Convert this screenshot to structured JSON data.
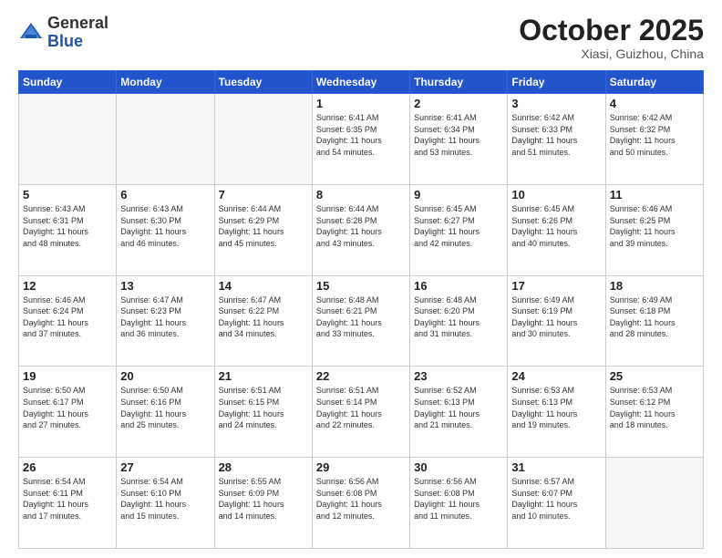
{
  "header": {
    "logo_general": "General",
    "logo_blue": "Blue",
    "month_title": "October 2025",
    "location": "Xiasi, Guizhou, China"
  },
  "days_of_week": [
    "Sunday",
    "Monday",
    "Tuesday",
    "Wednesday",
    "Thursday",
    "Friday",
    "Saturday"
  ],
  "weeks": [
    [
      {
        "day": "",
        "info": ""
      },
      {
        "day": "",
        "info": ""
      },
      {
        "day": "",
        "info": ""
      },
      {
        "day": "1",
        "info": "Sunrise: 6:41 AM\nSunset: 6:35 PM\nDaylight: 11 hours\nand 54 minutes."
      },
      {
        "day": "2",
        "info": "Sunrise: 6:41 AM\nSunset: 6:34 PM\nDaylight: 11 hours\nand 53 minutes."
      },
      {
        "day": "3",
        "info": "Sunrise: 6:42 AM\nSunset: 6:33 PM\nDaylight: 11 hours\nand 51 minutes."
      },
      {
        "day": "4",
        "info": "Sunrise: 6:42 AM\nSunset: 6:32 PM\nDaylight: 11 hours\nand 50 minutes."
      }
    ],
    [
      {
        "day": "5",
        "info": "Sunrise: 6:43 AM\nSunset: 6:31 PM\nDaylight: 11 hours\nand 48 minutes."
      },
      {
        "day": "6",
        "info": "Sunrise: 6:43 AM\nSunset: 6:30 PM\nDaylight: 11 hours\nand 46 minutes."
      },
      {
        "day": "7",
        "info": "Sunrise: 6:44 AM\nSunset: 6:29 PM\nDaylight: 11 hours\nand 45 minutes."
      },
      {
        "day": "8",
        "info": "Sunrise: 6:44 AM\nSunset: 6:28 PM\nDaylight: 11 hours\nand 43 minutes."
      },
      {
        "day": "9",
        "info": "Sunrise: 6:45 AM\nSunset: 6:27 PM\nDaylight: 11 hours\nand 42 minutes."
      },
      {
        "day": "10",
        "info": "Sunrise: 6:45 AM\nSunset: 6:26 PM\nDaylight: 11 hours\nand 40 minutes."
      },
      {
        "day": "11",
        "info": "Sunrise: 6:46 AM\nSunset: 6:25 PM\nDaylight: 11 hours\nand 39 minutes."
      }
    ],
    [
      {
        "day": "12",
        "info": "Sunrise: 6:46 AM\nSunset: 6:24 PM\nDaylight: 11 hours\nand 37 minutes."
      },
      {
        "day": "13",
        "info": "Sunrise: 6:47 AM\nSunset: 6:23 PM\nDaylight: 11 hours\nand 36 minutes."
      },
      {
        "day": "14",
        "info": "Sunrise: 6:47 AM\nSunset: 6:22 PM\nDaylight: 11 hours\nand 34 minutes."
      },
      {
        "day": "15",
        "info": "Sunrise: 6:48 AM\nSunset: 6:21 PM\nDaylight: 11 hours\nand 33 minutes."
      },
      {
        "day": "16",
        "info": "Sunrise: 6:48 AM\nSunset: 6:20 PM\nDaylight: 11 hours\nand 31 minutes."
      },
      {
        "day": "17",
        "info": "Sunrise: 6:49 AM\nSunset: 6:19 PM\nDaylight: 11 hours\nand 30 minutes."
      },
      {
        "day": "18",
        "info": "Sunrise: 6:49 AM\nSunset: 6:18 PM\nDaylight: 11 hours\nand 28 minutes."
      }
    ],
    [
      {
        "day": "19",
        "info": "Sunrise: 6:50 AM\nSunset: 6:17 PM\nDaylight: 11 hours\nand 27 minutes."
      },
      {
        "day": "20",
        "info": "Sunrise: 6:50 AM\nSunset: 6:16 PM\nDaylight: 11 hours\nand 25 minutes."
      },
      {
        "day": "21",
        "info": "Sunrise: 6:51 AM\nSunset: 6:15 PM\nDaylight: 11 hours\nand 24 minutes."
      },
      {
        "day": "22",
        "info": "Sunrise: 6:51 AM\nSunset: 6:14 PM\nDaylight: 11 hours\nand 22 minutes."
      },
      {
        "day": "23",
        "info": "Sunrise: 6:52 AM\nSunset: 6:13 PM\nDaylight: 11 hours\nand 21 minutes."
      },
      {
        "day": "24",
        "info": "Sunrise: 6:53 AM\nSunset: 6:13 PM\nDaylight: 11 hours\nand 19 minutes."
      },
      {
        "day": "25",
        "info": "Sunrise: 6:53 AM\nSunset: 6:12 PM\nDaylight: 11 hours\nand 18 minutes."
      }
    ],
    [
      {
        "day": "26",
        "info": "Sunrise: 6:54 AM\nSunset: 6:11 PM\nDaylight: 11 hours\nand 17 minutes."
      },
      {
        "day": "27",
        "info": "Sunrise: 6:54 AM\nSunset: 6:10 PM\nDaylight: 11 hours\nand 15 minutes."
      },
      {
        "day": "28",
        "info": "Sunrise: 6:55 AM\nSunset: 6:09 PM\nDaylight: 11 hours\nand 14 minutes."
      },
      {
        "day": "29",
        "info": "Sunrise: 6:56 AM\nSunset: 6:08 PM\nDaylight: 11 hours\nand 12 minutes."
      },
      {
        "day": "30",
        "info": "Sunrise: 6:56 AM\nSunset: 6:08 PM\nDaylight: 11 hours\nand 11 minutes."
      },
      {
        "day": "31",
        "info": "Sunrise: 6:57 AM\nSunset: 6:07 PM\nDaylight: 11 hours\nand 10 minutes."
      },
      {
        "day": "",
        "info": ""
      }
    ]
  ]
}
